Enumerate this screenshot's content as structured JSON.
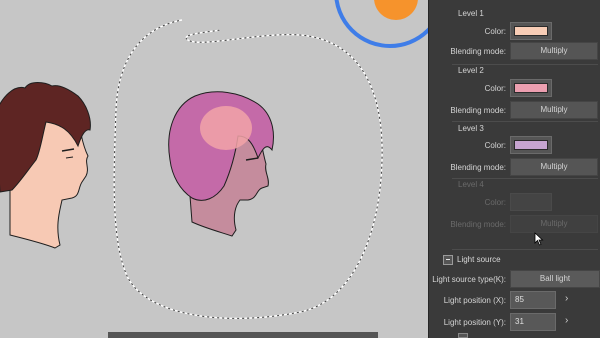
{
  "levels": [
    {
      "header": "Level 1",
      "color_label": "Color:",
      "color": "#f8cdb6",
      "blend_label": "Blending mode:",
      "blend_value": "Multiply",
      "enabled": true
    },
    {
      "header": "Level 2",
      "color_label": "Color:",
      "color": "#ec9fb0",
      "blend_label": "Blending mode:",
      "blend_value": "Multiply",
      "enabled": true
    },
    {
      "header": "Level 3",
      "color_label": "Color:",
      "color": "#c6a4d0",
      "blend_label": "Blending mode:",
      "blend_value": "Multiply",
      "enabled": true
    },
    {
      "header": "Level 4",
      "color_label": "Color:",
      "color": "#454545",
      "blend_label": "Blending mode:",
      "blend_value": "Multiply",
      "enabled": false
    }
  ],
  "light_source": {
    "title": "Light source",
    "type_label": "Light source type(K):",
    "type_value": "Ball light",
    "pos_x_label": "Light position (X):",
    "pos_x_value": "85",
    "pos_y_label": "Light position (Y):",
    "pos_y_value": "31"
  },
  "colors": {
    "canvas_bg": "#c6c6c6",
    "panel_bg": "#3a3a3a",
    "light_ring": "#3f7de8",
    "light_sun": "#f6932c"
  }
}
